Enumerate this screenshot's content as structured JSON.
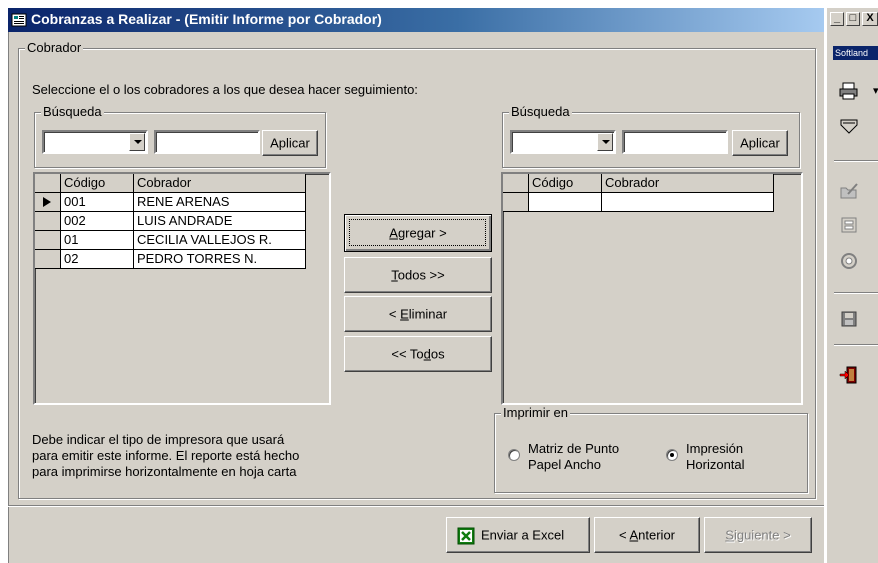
{
  "window": {
    "title": "Cobranzas a Realizar - (Emitir Informe por Cobrador)"
  },
  "caption_buttons": [
    "_",
    "□",
    "X"
  ],
  "sidebar": {
    "brand": "Softland",
    "icons": [
      "printer-icon",
      "filter-icon",
      "edit-folder-icon",
      "properties-icon",
      "gear-icon",
      "save-icon",
      "exit-door-icon"
    ]
  },
  "cobrador": {
    "legend": "Cobrador",
    "instruction": "Seleccione el o los cobradores a los que desea hacer seguimiento:"
  },
  "left_search": {
    "legend": "Búsqueda",
    "combo_value": "",
    "input_value": "",
    "apply_label": "Aplicar"
  },
  "right_search": {
    "legend": "Búsqueda",
    "combo_value": "",
    "input_value": "",
    "apply_label": "Aplicar"
  },
  "left_grid": {
    "columns": [
      "Código",
      "Cobrador"
    ],
    "rows": [
      {
        "codigo": "001",
        "cobrador": "RENE ARENAS"
      },
      {
        "codigo": "002",
        "cobrador": "LUIS ANDRADE"
      },
      {
        "codigo": "01",
        "cobrador": "CECILIA VALLEJOS R."
      },
      {
        "codigo": "02",
        "cobrador": "PEDRO TORRES N."
      }
    ]
  },
  "right_grid": {
    "columns": [
      "Código",
      "Cobrador"
    ],
    "rows": []
  },
  "transfer_buttons": {
    "agregar": {
      "pre": "",
      "key": "A",
      "post": "gregar >"
    },
    "todos": {
      "pre": "",
      "key": "T",
      "post": "odos >>"
    },
    "eliminar": {
      "pre": "< ",
      "key": "E",
      "post": "liminar"
    },
    "todos_back": {
      "pre": "<< To",
      "key": "d",
      "post": "os"
    }
  },
  "note": {
    "lines": [
      "Debe indicar el tipo de impresora que usará",
      "para emitir este informe. El reporte está hecho",
      "para imprimirse horizontalmente en hoja carta"
    ]
  },
  "imprimir": {
    "legend": "Imprimir en",
    "options": [
      {
        "line1": "Matriz de Punto",
        "line2": "Papel Ancho",
        "selected": false
      },
      {
        "line1": "Impresión",
        "line2": "Horizontal",
        "selected": true
      }
    ]
  },
  "footer": {
    "excel_label": "Enviar a Excel",
    "anterior": {
      "pre": "< ",
      "key": "A",
      "post": "nterior"
    },
    "siguiente": {
      "pre": "",
      "key": "S",
      "post": "iguiente >"
    }
  }
}
